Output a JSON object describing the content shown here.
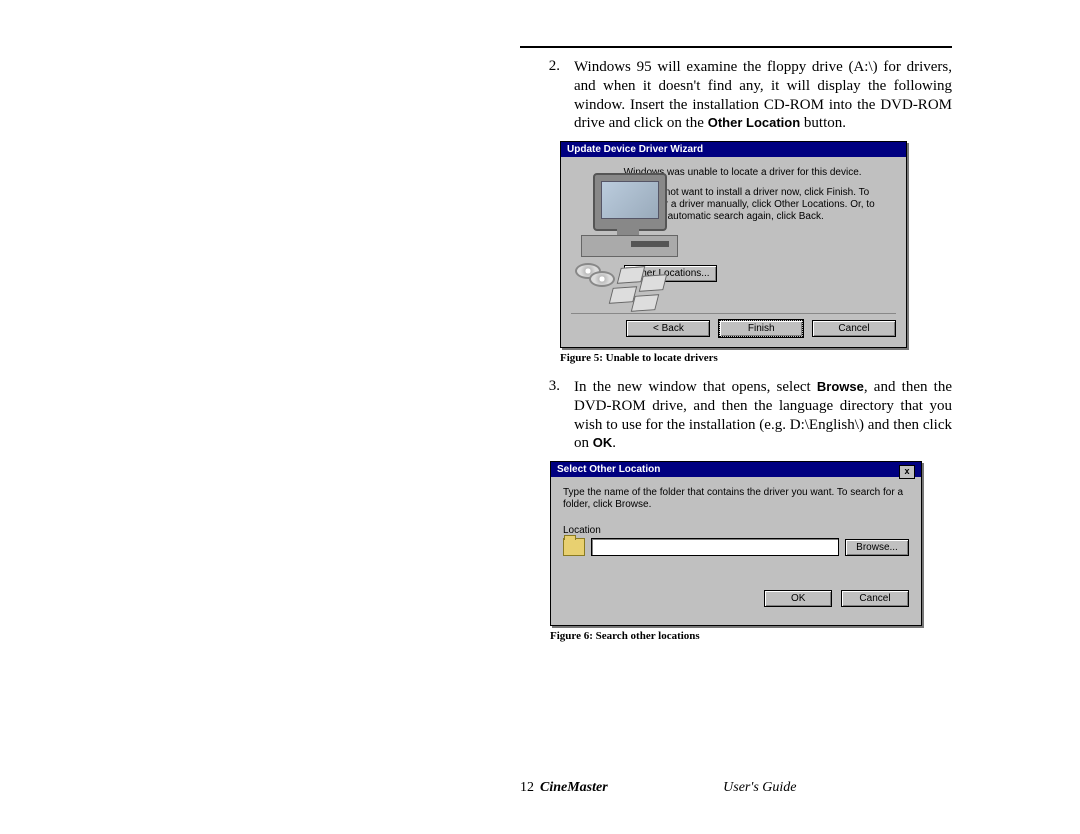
{
  "step2": {
    "num": "2.",
    "text_a": "Windows 95 will examine the floppy drive (A:\\) for drivers, and when it doesn't find any, it will display the following window. Insert the installation CD-ROM into the DVD-ROM drive and click on the ",
    "bold": "Other Location",
    "text_b": " button."
  },
  "dlg1": {
    "title": "Update Device Driver Wizard",
    "msg1": "Windows was unable to locate a driver for this device.",
    "msg2": "If you do not want to install a driver now, click Finish. To search for a driver manually, click Other Locations. Or, to begin the automatic search again, click Back.",
    "other": "Other Locations...",
    "back": "< Back",
    "finish": "Finish",
    "cancel": "Cancel"
  },
  "caption1": "Figure 5: Unable to locate drivers",
  "step3": {
    "num": "3.",
    "text_a": "In the new window that opens, select ",
    "bold1": "Browse",
    "text_b": ", and then the DVD-ROM drive, and then the language directory that you wish to use for the installation (e.g. D:\\English\\) and then click on ",
    "bold2": "OK",
    "text_c": "."
  },
  "dlg2": {
    "title": "Select Other Location",
    "msg": "Type the name of the folder that contains the driver you want. To search for a folder, click Browse.",
    "loc_label": "Location",
    "browse": "Browse...",
    "ok": "OK",
    "cancel": "Cancel"
  },
  "caption2": "Figure 6: Search other locations",
  "footer": {
    "page": "12",
    "product": "CineMaster",
    "guide": "User's Guide"
  }
}
